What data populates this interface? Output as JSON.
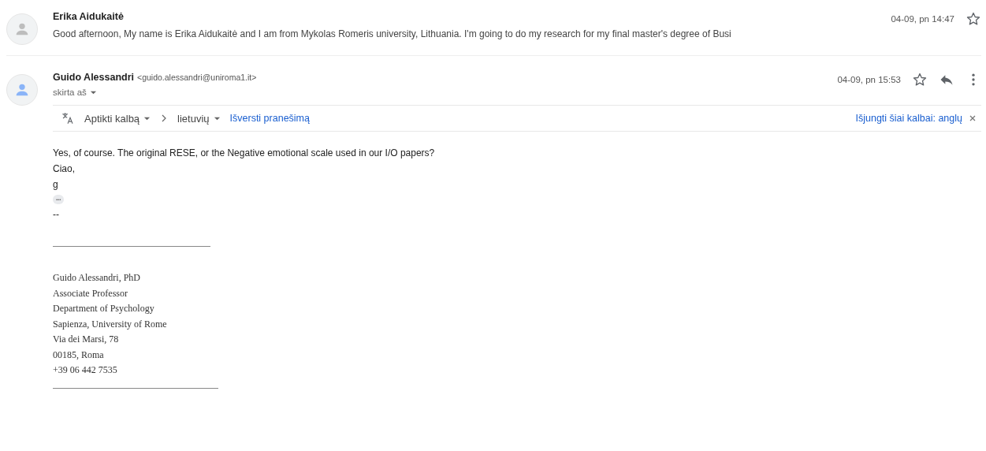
{
  "messages": [
    {
      "expanded": false,
      "avatar": {
        "color": "#bdbdbd"
      },
      "sender": "Erika Aidukaitė",
      "date": "04-09, pn 14:47",
      "starred": false,
      "snippet": "Good afternoon, My name is Erika Aidukaitė and I am from Mykolas Romeris university, Lithuania. I'm going to do my research for my final master's degree of Busi"
    },
    {
      "expanded": true,
      "avatar": {
        "color": "#8ab4f8"
      },
      "sender": "Guido Alessandri",
      "email": "<guido.alessandri@uniroma1.it>",
      "date": "04-09, pn 15:53",
      "starred": false,
      "recipient": "skirta aš",
      "translate_bar": {
        "source": "Aptikti kalbą",
        "target": "lietuvių",
        "translate_link": "Išversti pranešimą",
        "disable_link": "Išjungti šiai kalbai: anglų"
      },
      "body": [
        "Yes, of course. The original RESE, or the Negative emotional scale used in our I/O papers?",
        "Ciao,",
        "g"
      ],
      "trimmed_toggle": "•••",
      "signature_dash": "--",
      "signature": [
        "Guido Alessandri, PhD",
        "Associate Professor",
        "Department of Psychology",
        "Sapienza, University of Rome",
        "Via dei Marsi, 78",
        "00185, Roma",
        "+39 06 442 7535"
      ]
    }
  ]
}
